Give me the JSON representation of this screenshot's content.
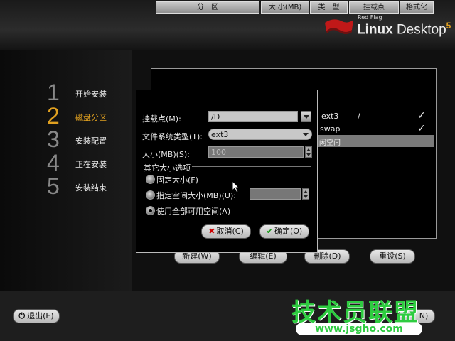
{
  "brand": {
    "small": "Red Flag",
    "bold": "Linux",
    "light": " Desktop",
    "version": "5"
  },
  "steps": [
    {
      "num": "1",
      "label": "开始安装"
    },
    {
      "num": "2",
      "label": "磁盘分区"
    },
    {
      "num": "3",
      "label": "安装配置"
    },
    {
      "num": "4",
      "label": "正在安装"
    },
    {
      "num": "5",
      "label": "安装结束"
    }
  ],
  "table": {
    "headers": [
      "分　区",
      "大 小(MB)",
      "类　型",
      "挂载点",
      "格式化"
    ],
    "rows": [
      {
        "type": "ext3",
        "mount": "/",
        "format": "✓"
      },
      {
        "type": "swap",
        "mount": "",
        "format": "✓"
      },
      {
        "type": "闲空间"
      }
    ]
  },
  "dialog": {
    "mount_label": "挂载点(M):",
    "mount_value": "/D",
    "fs_label": "文件系统类型(T):",
    "fs_value": "ext3",
    "size_label": "大小(MB)(S):",
    "size_value": "100",
    "other_options_label": "其它大小选项",
    "radio_fixed": "固定大小(F)",
    "radio_specify": "指定空间大小(MB)(U):",
    "radio_fill": "使用全部可用空间(A)",
    "cancel": "取消(C)",
    "ok": "确定(O)"
  },
  "actions": {
    "new": "新建(W)",
    "edit": "编辑(E)",
    "delete": "删除(D)",
    "reset": "重设(S)"
  },
  "footer": {
    "exit": "退出(E)",
    "next_partial": "N)"
  },
  "watermark": {
    "text": "技术员联盟",
    "url": "www.jsgho.com"
  }
}
